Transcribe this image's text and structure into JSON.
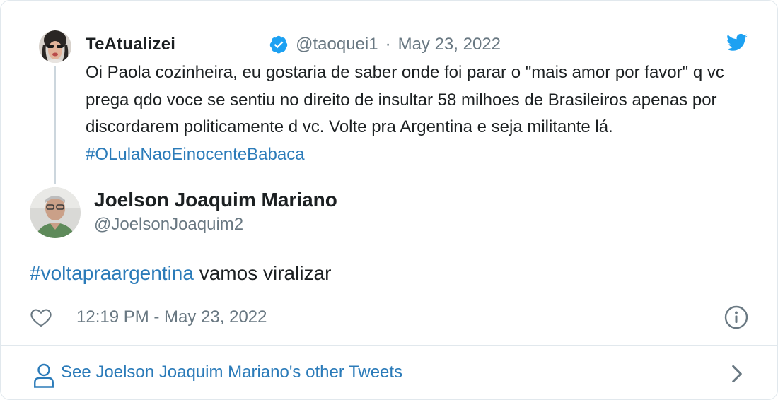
{
  "parent_tweet": {
    "display_name": "TeAtualizei",
    "handle": "@taoquei1",
    "separator": "·",
    "date": "May 23, 2022",
    "text": "Oi Paola cozinheira, eu gostaria de saber onde foi parar o \"mais amor por favor\" q vc prega qdo voce se sentiu no direito de insultar 58 milhoes de Brasileiros apenas por discordarem politicamente d vc. Volte pra Argentina e seja militante lá. ",
    "hashtag": "#OLulaNaoEinocenteBabaca",
    "verified": true
  },
  "tweet": {
    "display_name": "Joelson Joaquim Mariano",
    "handle": "@JoelsonJoaquim2",
    "hashtag": "#voltapraargentina",
    "text": " vamos viralizar",
    "timestamp": "12:19 PM - May 23, 2022"
  },
  "footer": {
    "other_tweets_label": "See Joelson Joaquim Mariano's other Tweets"
  },
  "icons": {
    "brand": "twitter-bird-icon",
    "verified": "verified-badge-icon",
    "like": "heart-icon",
    "info": "info-icon",
    "user": "user-icon",
    "chevron": "chevron-right-icon"
  },
  "colors": {
    "link": "#2b7bb9",
    "twitter_blue": "#1da1f2",
    "secondary_text": "#697882",
    "primary_text": "#1c2022",
    "border": "#e1e8ed"
  }
}
